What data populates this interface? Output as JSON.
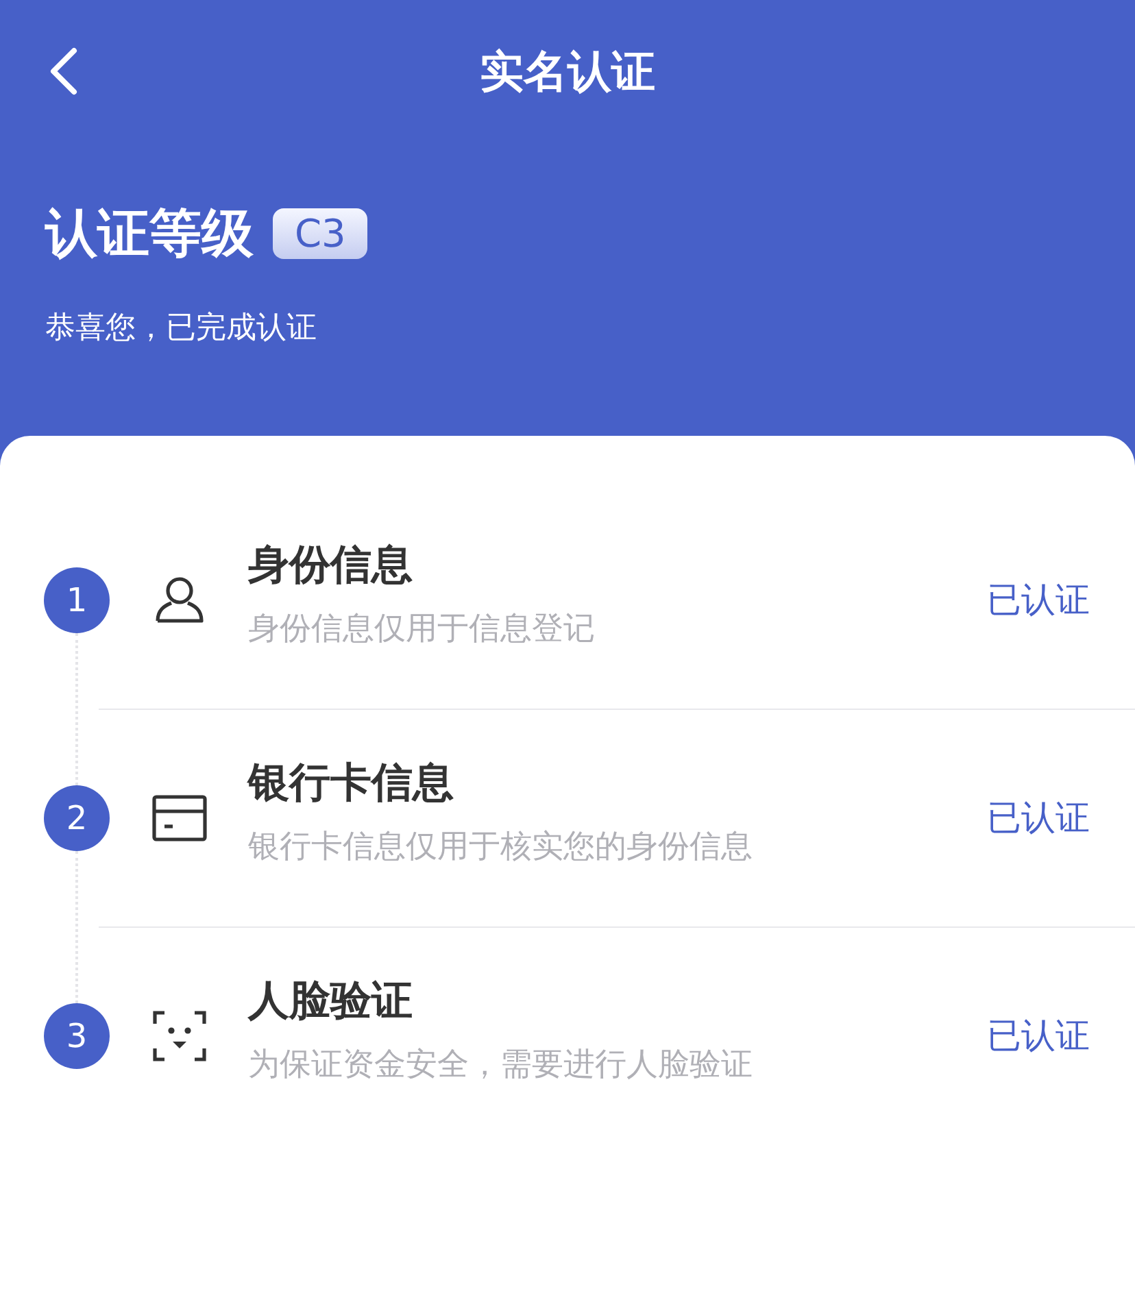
{
  "nav": {
    "title": "实名认证"
  },
  "level": {
    "title": "认证等级",
    "badge": "C3",
    "message": "恭喜您，已完成认证"
  },
  "steps": [
    {
      "number": "1",
      "kind": "person",
      "title": "身份信息",
      "description": "身份信息仅用于信息登记",
      "status": "已认证"
    },
    {
      "number": "2",
      "kind": "card",
      "title": "银行卡信息",
      "description": "银行卡信息仅用于核实您的身份信息",
      "status": "已认证"
    },
    {
      "number": "3",
      "kind": "face",
      "title": "人脸验证",
      "description": "为保证资金安全，需要进行人脸验证",
      "status": "已认证"
    }
  ]
}
